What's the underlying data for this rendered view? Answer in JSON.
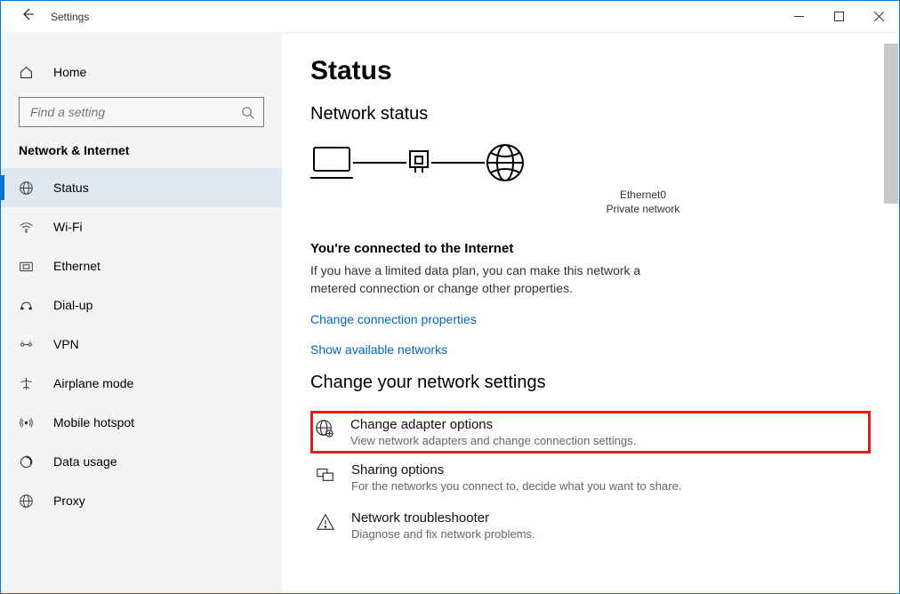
{
  "window": {
    "title": "Settings"
  },
  "sidebar": {
    "home": "Home",
    "search_placeholder": "Find a setting",
    "heading": "Network & Internet",
    "items": [
      {
        "label": "Status"
      },
      {
        "label": "Wi-Fi"
      },
      {
        "label": "Ethernet"
      },
      {
        "label": "Dial-up"
      },
      {
        "label": "VPN"
      },
      {
        "label": "Airplane mode"
      },
      {
        "label": "Mobile hotspot"
      },
      {
        "label": "Data usage"
      },
      {
        "label": "Proxy"
      }
    ]
  },
  "main": {
    "title": "Status",
    "status_heading": "Network status",
    "adapter": "Ethernet0",
    "adapter_type": "Private network",
    "connected_title": "You're connected to the Internet",
    "connected_desc": "If you have a limited data plan, you can make this network a metered connection or change other properties.",
    "link1": "Change connection properties",
    "link2": "Show available networks",
    "settings_heading": "Change your network settings",
    "opts": [
      {
        "title": "Change adapter options",
        "sub": "View network adapters and change connection settings."
      },
      {
        "title": "Sharing options",
        "sub": "For the networks you connect to, decide what you want to share."
      },
      {
        "title": "Network troubleshooter",
        "sub": "Diagnose and fix network problems."
      }
    ]
  }
}
